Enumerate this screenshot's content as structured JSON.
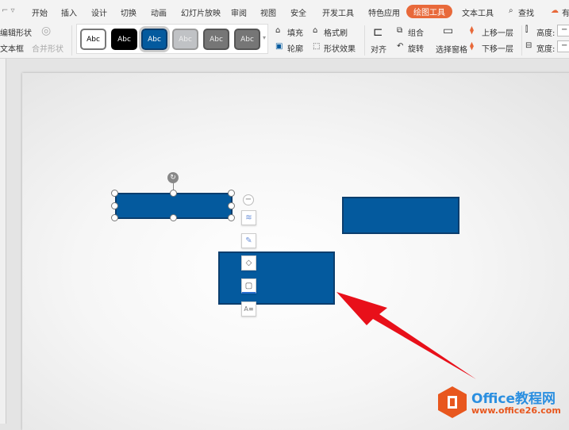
{
  "tabs": {
    "items": [
      "开始",
      "插入",
      "设计",
      "切换",
      "动画",
      "幻灯片放映",
      "审阅",
      "视图",
      "安全",
      "开发工具",
      "特色应用",
      "绘图工具",
      "文本工具"
    ],
    "active": "绘图工具",
    "search": "查找",
    "extra": "有"
  },
  "ribbon": {
    "edit_shape": "编辑形状",
    "textbox": "文本框",
    "merge_shape": "合并形状",
    "styles": [
      "Abc",
      "Abc",
      "Abc",
      "Abc",
      "Abc",
      "Abc"
    ],
    "fill": "填充",
    "format_painter": "格式刷",
    "outline": "轮廓",
    "shape_effects": "形状效果",
    "align": "对齐",
    "group": "组合",
    "rotate": "旋转",
    "selection_pane": "选择窗格",
    "bring_forward": "上移一层",
    "send_backward": "下移一层",
    "height_label": "高度:",
    "width_label": "宽度:",
    "height_value": "−",
    "width_value": "−"
  },
  "watermark": {
    "title": "Office教程网",
    "url": "www.office26.com"
  },
  "colors": {
    "accent": "#e8693a",
    "shape": "#045a9e",
    "arrow": "#e8101a"
  }
}
